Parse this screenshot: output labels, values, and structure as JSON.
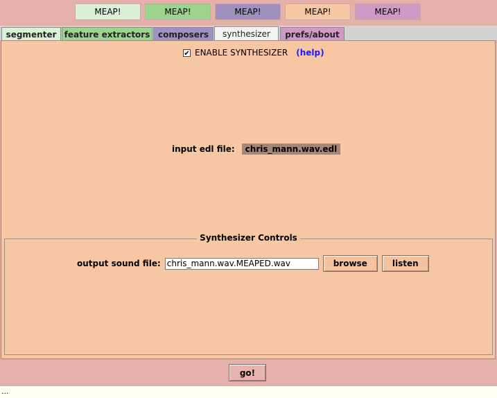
{
  "meap_buttons": [
    {
      "label": "MEAP!",
      "color": "#d9f2d5"
    },
    {
      "label": "MEAP!",
      "color": "#9ed38f"
    },
    {
      "label": "MEAP!",
      "color": "#9f90bf"
    },
    {
      "label": "MEAP!",
      "color": "#f7c6a3"
    },
    {
      "label": "MEAP!",
      "color": "#d19ac6"
    }
  ],
  "tabs": [
    {
      "label": "segmenter",
      "color": "#d9f2d5"
    },
    {
      "label": "feature extractors",
      "color": "#9ed38f"
    },
    {
      "label": "composers",
      "color": "#9f90bf"
    },
    {
      "label": "synthesizer",
      "color": "#f3f3f3"
    },
    {
      "label": "prefs/about",
      "color": "#d19ac6"
    }
  ],
  "synth": {
    "enable_checked": true,
    "enable_label": "ENABLE SYNTHESIZER",
    "help_label": "(help)",
    "input_edl_label": "input edl file:",
    "input_edl_value": "chris_mann.wav.edl",
    "controls_title": "Synthesizer Controls",
    "output_label": "output sound file:",
    "output_value": "chris_mann.wav.MEAPED.wav",
    "browse_label": "browse",
    "listen_label": "listen"
  },
  "go_label": "go!",
  "status_text": "..."
}
